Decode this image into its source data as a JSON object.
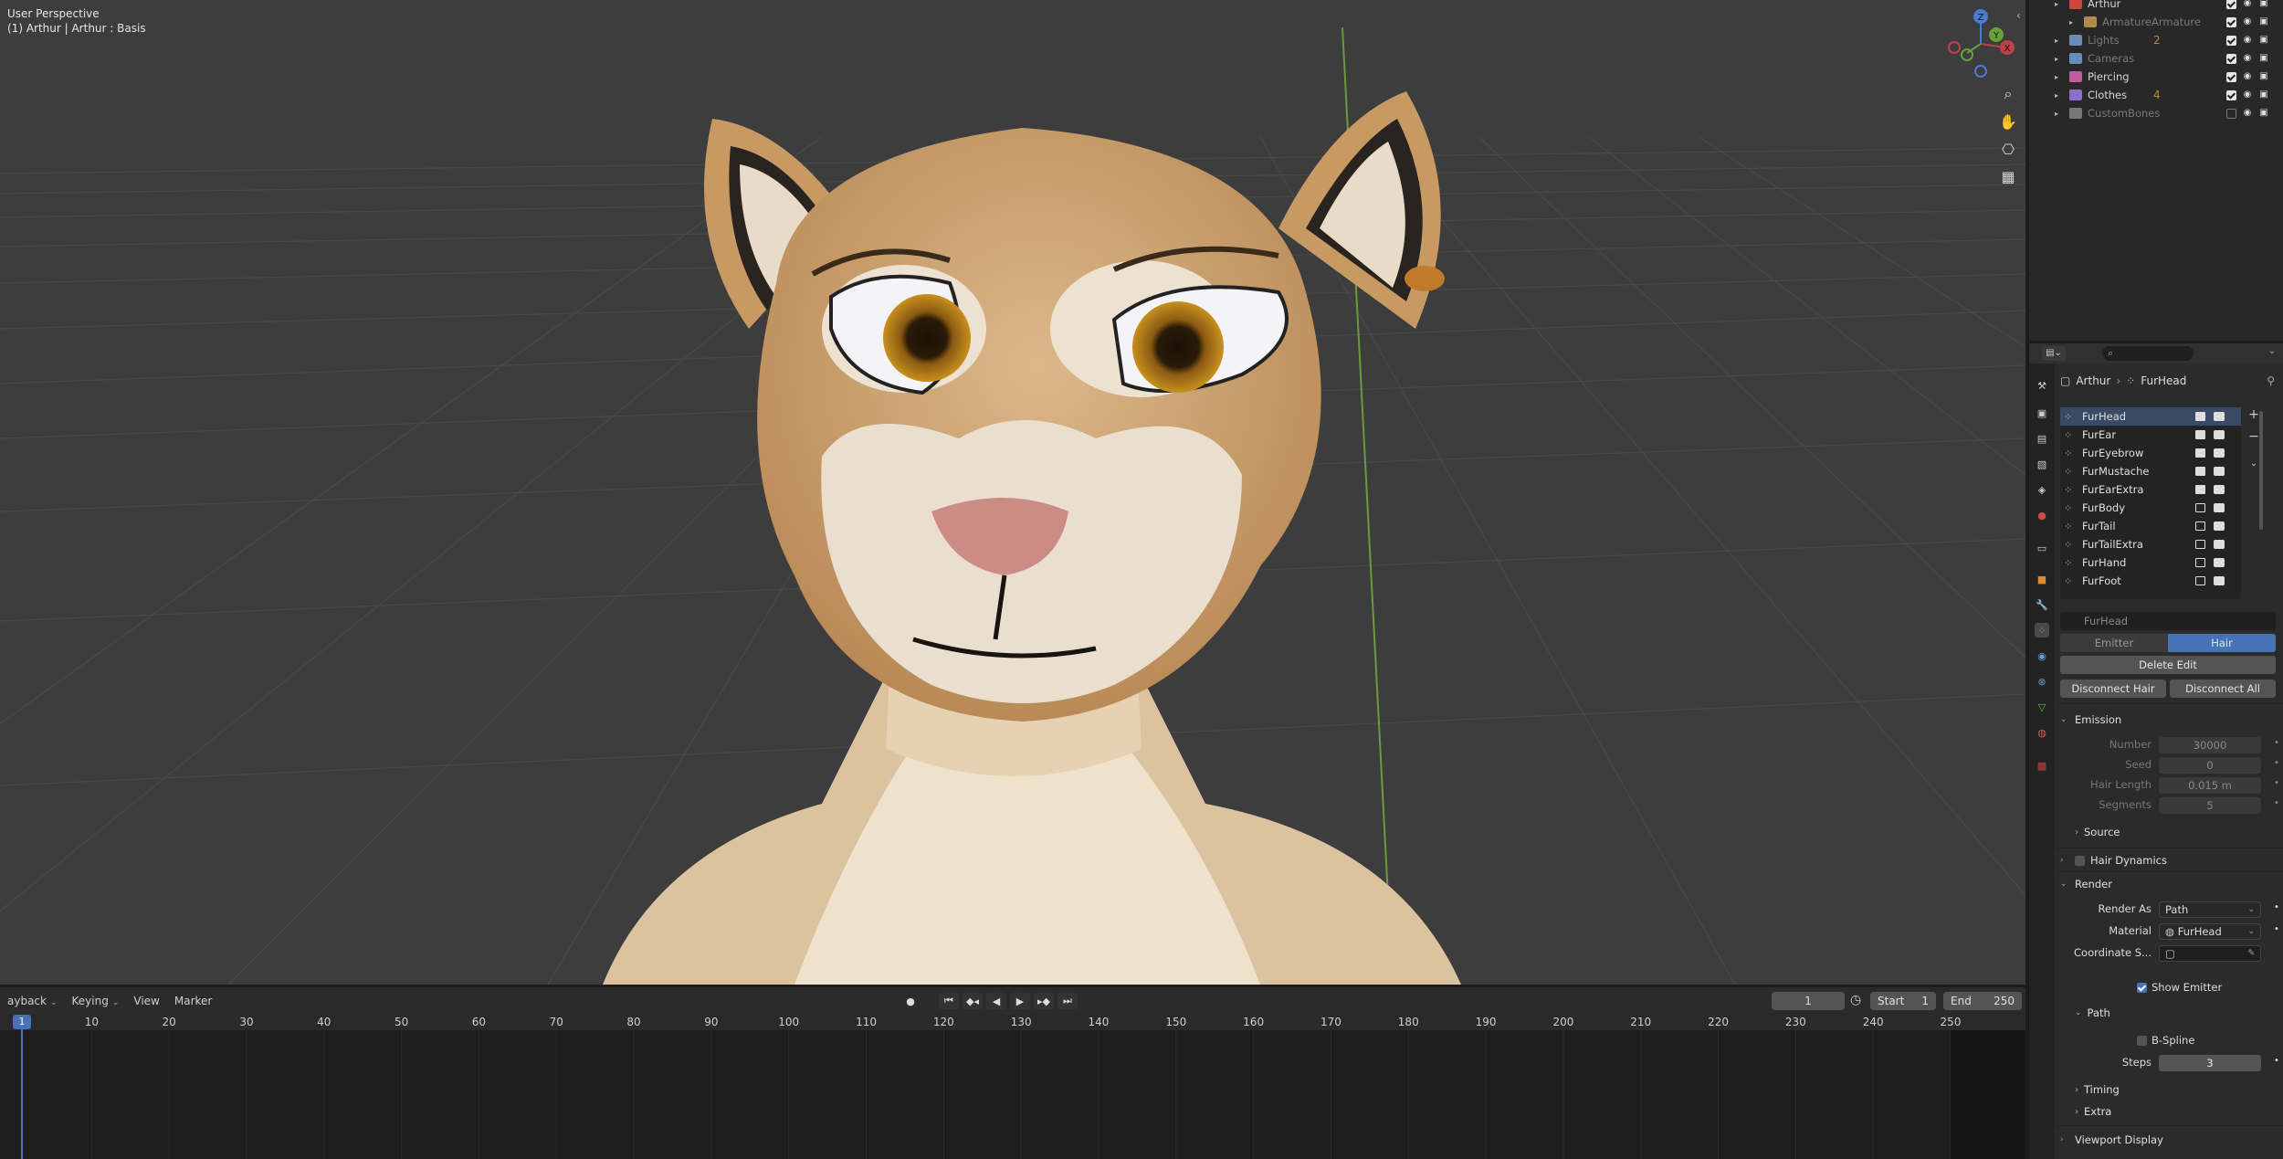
{
  "viewport": {
    "title": "User Perspective",
    "subtitle": "(1) Arthur | Arthur : Basis",
    "gizmo_axes": [
      "X",
      "Y",
      "Z"
    ]
  },
  "outliner": {
    "rows": [
      {
        "label": "Arthur",
        "color": "#d0453d",
        "checked": true,
        "muted": false,
        "count": ""
      },
      {
        "label": "ArmatureArmature",
        "color": "#b08a4a",
        "checked": true,
        "muted": true,
        "count": ""
      },
      {
        "label": "Lights",
        "color": "#6a8cb8",
        "checked": true,
        "muted": true,
        "count": "2"
      },
      {
        "label": "Cameras",
        "color": "#6a8cb8",
        "checked": true,
        "muted": true,
        "count": ""
      },
      {
        "label": "Piercing",
        "color": "#c25b9b",
        "checked": true,
        "muted": false,
        "count": ""
      },
      {
        "label": "Clothes",
        "color": "#8b6cc6",
        "checked": true,
        "muted": false,
        "count": "4"
      },
      {
        "label": "CustomBones",
        "color": "#777777",
        "checked": false,
        "muted": true,
        "count": ""
      }
    ]
  },
  "properties": {
    "breadcrumb": {
      "object": "Arthur",
      "system": "FurHead"
    },
    "particle_systems": [
      "FurHead",
      "FurEar",
      "FurEyebrow",
      "FurMustache",
      "FurEarExtra",
      "FurBody",
      "FurTail",
      "FurTailExtra",
      "FurHand",
      "FurFoot"
    ],
    "particle_name": "FurHead",
    "type_tabs": {
      "emitter": "Emitter",
      "hair": "Hair"
    },
    "delete_edit": "Delete Edit",
    "disconnect_hair": "Disconnect Hair",
    "disconnect_all": "Disconnect All",
    "emission": {
      "label": "Emission",
      "number_label": "Number",
      "number": "30000",
      "seed_label": "Seed",
      "seed": "0",
      "hair_length_label": "Hair Length",
      "hair_length": "0.015 m",
      "segments_label": "Segments",
      "segments": "5"
    },
    "source": "Source",
    "hair_dynamics": "Hair Dynamics",
    "render": {
      "label": "Render",
      "render_as_label": "Render As",
      "render_as": "Path",
      "material_label": "Material",
      "material": "FurHead",
      "coord_label": "Coordinate S...",
      "show_emitter": "Show Emitter"
    },
    "path": {
      "label": "Path",
      "bspline": "B-Spline",
      "steps_label": "Steps",
      "steps": "3"
    },
    "timing": "Timing",
    "extra": "Extra",
    "viewport_display": "Viewport Display"
  },
  "timeline": {
    "menus": [
      "ayback",
      "Keying",
      "View",
      "Marker"
    ],
    "current_frame": "1",
    "start_label": "Start",
    "start": "1",
    "end_label": "End",
    "end": "250",
    "ticks": [
      "10",
      "20",
      "30",
      "40",
      "50",
      "60",
      "70",
      "80",
      "90",
      "100",
      "110",
      "120",
      "130",
      "140",
      "150",
      "160",
      "170",
      "180",
      "190",
      "200",
      "210",
      "220",
      "230",
      "240",
      "250"
    ],
    "playhead": "1"
  },
  "colors": {
    "accent": "#4772b3",
    "viewport_bg": "#3d3d3d",
    "panel_bg": "#2b2b2b"
  }
}
